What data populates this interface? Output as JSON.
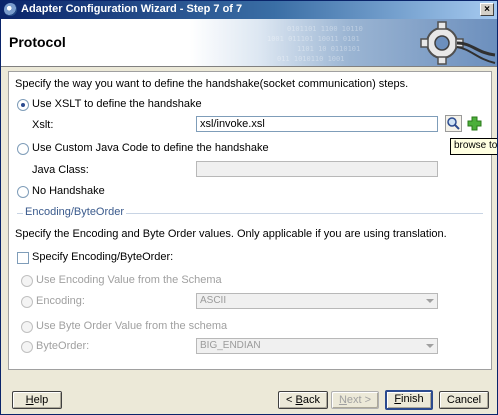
{
  "window": {
    "title": "Adapter Configuration Wizard - Step 7 of 7",
    "close_label": "×"
  },
  "header": {
    "page_title": "Protocol"
  },
  "content": {
    "intro": "Specify the way you want to define the handshake(socket communication) steps.",
    "xslt_option": {
      "label": "Use XSLT to define the handshake",
      "selected": true
    },
    "xslt_field": {
      "label": "Xslt:",
      "value": "xsl/invoke.xsl"
    },
    "tooltip": "browse to s",
    "java_option": {
      "label": "Use Custom Java Code to define the handshake",
      "selected": false
    },
    "java_field": {
      "label": "Java Class:",
      "value": ""
    },
    "no_handshake_option": {
      "label": "No Handshake",
      "selected": false
    },
    "encoding_section": {
      "title": "Encoding/ByteOrder",
      "description": "Specify the Encoding and Byte Order values. Only applicable if you are using translation.",
      "checkbox_label": "Specify Encoding/ByteOrder:",
      "checkbox_checked": false,
      "use_encoding_schema": "Use Encoding Value from the Schema",
      "encoding_label": "Encoding:",
      "encoding_value": "ASCII",
      "use_byteorder_schema": "Use Byte Order Value from the schema",
      "byteorder_label": "ByteOrder:",
      "byteorder_value": "BIG_ENDIAN"
    }
  },
  "buttons": {
    "help_mnemonic": "H",
    "help_rest": "elp",
    "back_prefix": "< ",
    "back_mnemonic": "B",
    "back_rest": "ack",
    "next_mnemonic": "N",
    "next_rest": "ext >",
    "finish_mnemonic": "F",
    "finish_rest": "inish",
    "cancel": "Cancel"
  }
}
